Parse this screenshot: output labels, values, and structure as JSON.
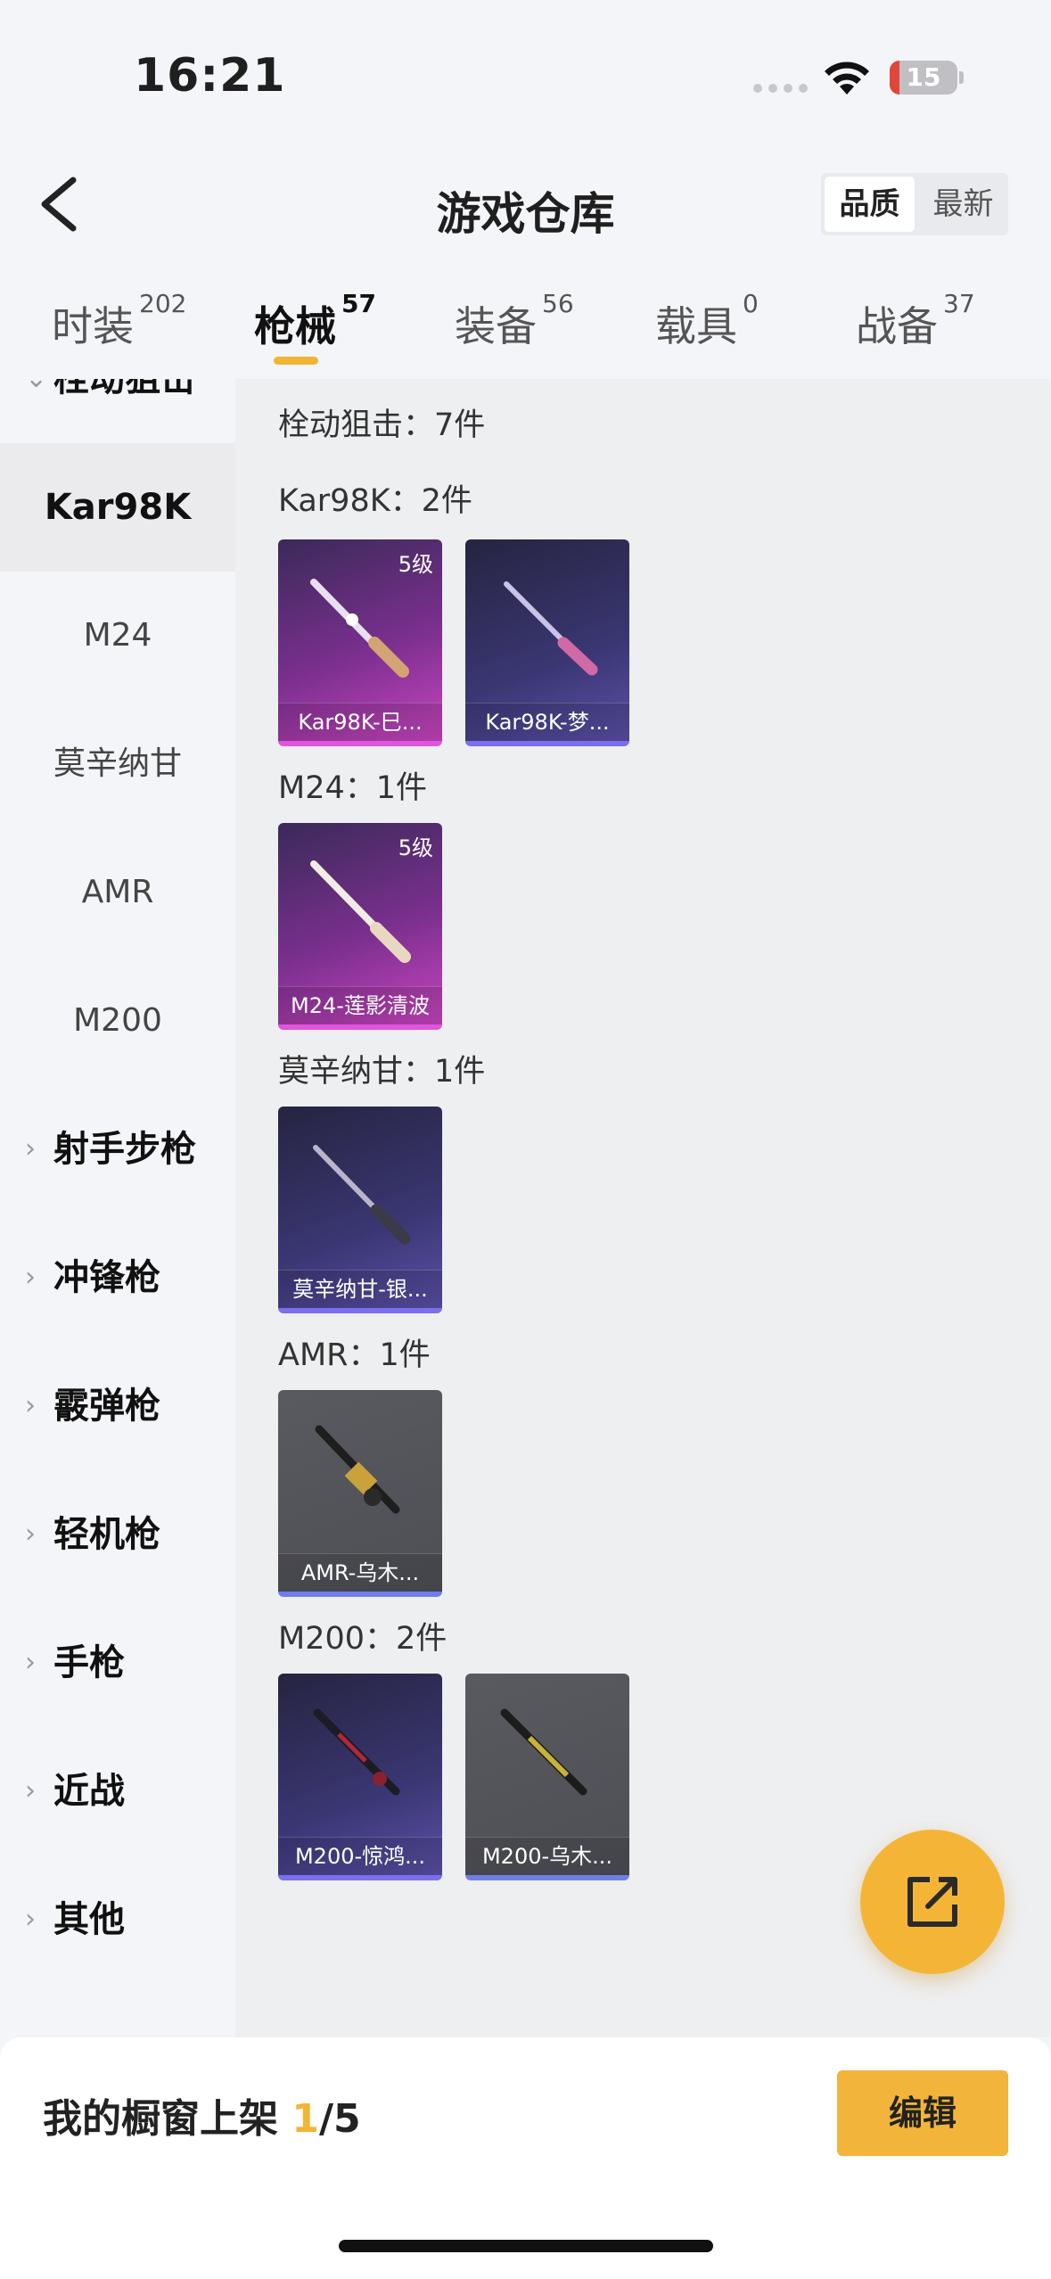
{
  "status_bar": {
    "time": "16:21",
    "battery": "15",
    "battery_level": 0.15
  },
  "header": {
    "title": "游戏仓库",
    "sort": {
      "active": "品质",
      "other": "最新"
    }
  },
  "tabs": [
    {
      "label": "时装",
      "count": "202"
    },
    {
      "label": "枪械",
      "count": "57"
    },
    {
      "label": "装备",
      "count": "56"
    },
    {
      "label": "载具",
      "count": "0"
    },
    {
      "label": "战备",
      "count": "37"
    }
  ],
  "sidebar": {
    "partial_group": "栓动狙击",
    "items": [
      "Kar98K",
      "M24",
      "莫辛纳甘",
      "AMR",
      "M200"
    ],
    "groups": [
      "射手步枪",
      "冲锋枪",
      "霰弹枪",
      "轻机枪",
      "手枪",
      "近战",
      "其他"
    ]
  },
  "content": {
    "summary": "栓动狙击：7件",
    "sections": [
      {
        "title": "Kar98K：2件",
        "cards": [
          {
            "name": "Kar98K-巳...",
            "level": "5级",
            "rarity": "pink"
          },
          {
            "name": "Kar98K-梦...",
            "level": "",
            "rarity": "purple"
          }
        ]
      },
      {
        "title": "M24：1件",
        "cards": [
          {
            "name": "M24-莲影清波",
            "level": "5级",
            "rarity": "pink"
          }
        ]
      },
      {
        "title": "莫辛纳甘：1件",
        "cards": [
          {
            "name": "莫辛纳甘-银...",
            "level": "",
            "rarity": "purple"
          }
        ]
      },
      {
        "title": "AMR：1件",
        "cards": [
          {
            "name": "AMR-乌木...",
            "level": "",
            "rarity": "gray"
          }
        ]
      },
      {
        "title": "M200：2件",
        "cards": [
          {
            "name": "M200-惊鸿...",
            "level": "",
            "rarity": "purple"
          },
          {
            "name": "M200-乌木...",
            "level": "",
            "rarity": "gray"
          }
        ]
      }
    ]
  },
  "bottom": {
    "shelf_label": "我的橱窗上架 ",
    "shelf_current": "1",
    "shelf_total": "/5",
    "edit": "编辑"
  },
  "icons": {
    "back": "back-arrow-icon",
    "share": "share-external-icon",
    "wifi": "wifi-icon",
    "battery": "battery-icon"
  },
  "colors": {
    "accent": "#f2b43a",
    "pink_rarity": "#df55dc",
    "purple_rarity": "#7b6ef0"
  }
}
